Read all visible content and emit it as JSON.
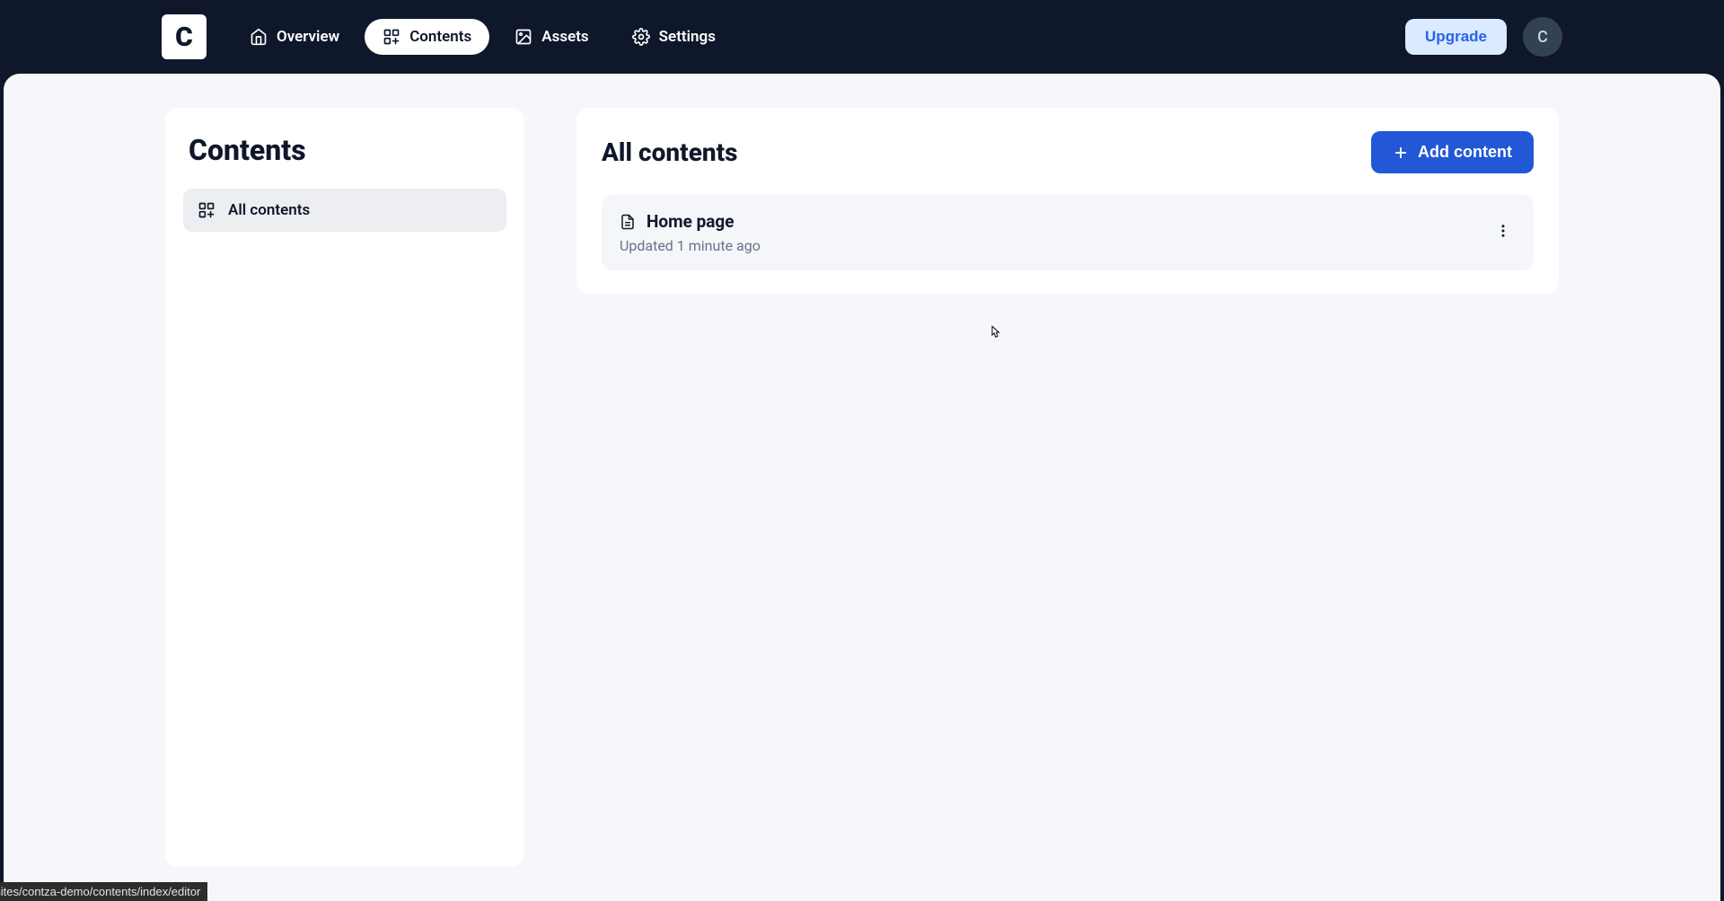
{
  "logo": {
    "letter": "C"
  },
  "nav": {
    "overview": "Overview",
    "contents": "Contents",
    "assets": "Assets",
    "settings": "Settings"
  },
  "topbar": {
    "upgrade": "Upgrade",
    "avatar_initial": "C"
  },
  "sidebar": {
    "title": "Contents",
    "all_contents": "All contents"
  },
  "main": {
    "title": "All contents",
    "add_label": "Add content",
    "items": [
      {
        "title": "Home page",
        "subtitle": "Updated 1 minute ago"
      }
    ]
  },
  "status_url": "https://app.contza.com/websites/contza-demo/contents/index/editor"
}
